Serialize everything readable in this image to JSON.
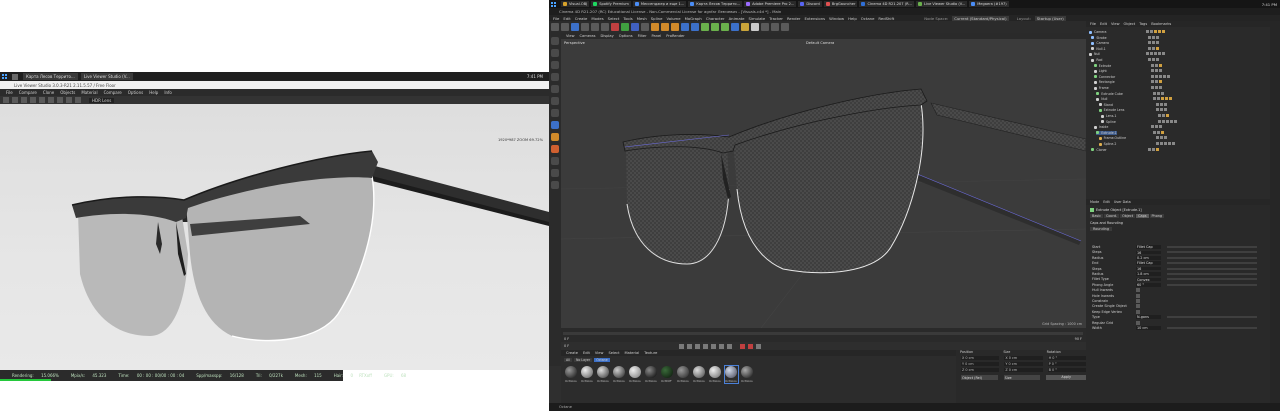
{
  "left_window": {
    "taskbar": {
      "tabs": [
        "Карта Лесов Террито...",
        "Live Viewer Studio (V..."
      ],
      "clock": "7:41 PM"
    },
    "titlebar": "Live Viewer Studio 3.0.3-R21 2.11.5.57 / Free Floor",
    "menus": [
      "File",
      "Compare",
      "Clone",
      "Objects",
      "Material",
      "Compare",
      "Options",
      "Help",
      "Info"
    ],
    "toolbar_dropdown": "HDR Lens",
    "viewport_label": "1920*987 ZOOM 69.72%",
    "status": {
      "rendering_label": "Rendering:",
      "rendering_value": "15.066%",
      "mpix_label": "Mpix/s:",
      "mpix_value": "45.323",
      "time_label": "Time:",
      "time_value": "00 : 00 : 00/00 : 00 : 04",
      "spp_label": "Spp/maxspp:",
      "spp_value": "16/128",
      "tri_label": "Tri:",
      "tri_value": "0/227k",
      "mesh_label": "Mesh:",
      "mesh_value": "115",
      "hair_label": "Hair:",
      "hair_value": "0",
      "rtx_label": "RTXoff",
      "gpu_label": "GPU:",
      "gpu_value": "68"
    },
    "progress": 0.15
  },
  "right_window": {
    "taskbar": {
      "tabs": [
        "Visual.OBJ",
        "Spotify Premium",
        "Мессенджер и еще 1...",
        "Карта Лесов Террито...",
        "Adobe Premiere Pro 2...",
        "Discord",
        "BrgGauncher",
        "Cinema 4D R21.207 (R...",
        "Live Viewer Studio (V...",
        "Megaera (#197)"
      ],
      "clock": "7:41 PM"
    },
    "titlebar": "Cinema 4D R21.207 (RC) Educational License - Non-Commercial License for agnfar Лемчевич - [Visuals.c4d *] - Main",
    "menus": [
      "File",
      "Edit",
      "Create",
      "Modes",
      "Select",
      "Tools",
      "Mesh",
      "Spline",
      "Volume",
      "MoGraph",
      "Character",
      "Animate",
      "Simulate",
      "Tracker",
      "Render",
      "Extensions",
      "Window",
      "Help",
      "Octane",
      "RedShift"
    ],
    "viewport_menus": [
      "View",
      "Cameras",
      "Display",
      "Options",
      "Filter",
      "Panel",
      "ProRender"
    ],
    "viewport_labels": {
      "camera": "Default Camera",
      "perspective": "Perspective",
      "grid_spacing": "Grid Spacing : 1000 cm"
    },
    "layout_label": "Layout:",
    "layout_value": "Startup (User)",
    "node_space_label": "Node Space:",
    "node_space_value": "Current (Standard/Physical)",
    "object_manager": {
      "menus": [
        "File",
        "Edit",
        "View",
        "Object",
        "Tags",
        "Bookmarks"
      ],
      "objects": [
        {
          "name": "Camera",
          "color": "#8fbfff"
        },
        {
          "name": "Stroke",
          "color": "#8fbfff"
        },
        {
          "name": "Camera",
          "color": "#8fbfff"
        },
        {
          "name": "Null.1",
          "color": "#cfcfcf"
        },
        {
          "name": "Null",
          "color": "#cfcfcf"
        },
        {
          "name": "Rod",
          "color": "#cfcfcf"
        },
        {
          "name": "Extrude",
          "color": "#7fd27f"
        },
        {
          "name": "Light",
          "color": "#cfcfcf"
        },
        {
          "name": "Connector",
          "color": "#7fd27f"
        },
        {
          "name": "Rectangle",
          "color": "#cfcfcf"
        },
        {
          "name": "Frame",
          "color": "#cfcfcf"
        },
        {
          "name": "Extrude Cube",
          "color": "#7fd27f"
        },
        {
          "name": "Null",
          "color": "#cfcfcf"
        },
        {
          "name": "Stand",
          "color": "#cfcfcf"
        },
        {
          "name": "Extrude Lens",
          "color": "#7fd27f"
        },
        {
          "name": "Lens.1",
          "color": "#cfcfcf"
        },
        {
          "name": "Spline",
          "color": "#cfcfcf"
        },
        {
          "name": "Inside",
          "color": "#cfcfcf"
        },
        {
          "name": "Extrude.1",
          "color": "#7fd27f"
        },
        {
          "name": "Frame.Outline",
          "color": "#e0b050"
        },
        {
          "name": "Spline.2",
          "color": "#e0b050"
        },
        {
          "name": "Cloner",
          "color": "#7fd27f"
        }
      ]
    },
    "attributes": {
      "menus": [
        "Mode",
        "Edit",
        "User Data"
      ],
      "object_title": "Extrude Object [Extrude.1]",
      "tabs": [
        "Basic",
        "Coord.",
        "Object",
        "Caps",
        "Phong"
      ],
      "section": "Caps and Rounding",
      "subsection": "Rounding",
      "rows": [
        {
          "label": "Start",
          "value": "Fillet Cap"
        },
        {
          "label": "Steps",
          "value": "16"
        },
        {
          "label": "Radius",
          "value": "0.2 cm"
        },
        {
          "label": "End",
          "value": "Fillet Cap"
        },
        {
          "label": "Steps",
          "value": "16"
        },
        {
          "label": "Radius",
          "value": "1.8 cm"
        },
        {
          "label": "Fillet Type",
          "value": "Convex"
        },
        {
          "label": "Phong Angle",
          "value": "60 °"
        },
        {
          "label": "Hull Inwards",
          "value": ""
        },
        {
          "label": "Hole Inwards",
          "value": ""
        },
        {
          "label": "Constrain",
          "value": ""
        },
        {
          "label": "Create Single Object",
          "value": ""
        },
        {
          "label": "Keep Edge Vertex",
          "value": ""
        },
        {
          "label": "Type",
          "value": "N-gons"
        },
        {
          "label": "Regular Grid",
          "value": ""
        },
        {
          "label": "Width",
          "value": "10 cm"
        }
      ]
    },
    "material_menus": [
      "Create",
      "Edit",
      "View",
      "Select",
      "Material",
      "Texture"
    ],
    "material_filter": [
      "All",
      "No Layer",
      "Octane"
    ],
    "materials": [
      "OctGlos",
      "OctGlos",
      "OctGlos",
      "OctGlos",
      "OctGlos",
      "OctGlos",
      "OctDiff",
      "OctGlos",
      "OctGlos",
      "OctGlos",
      "OctGlos",
      "OctGlos"
    ],
    "coordinates": {
      "headers": [
        "Position",
        "Size",
        "Rotation"
      ],
      "rows": [
        [
          "X  0 cm",
          "X  0 cm",
          "H  0 °"
        ],
        [
          "Y  0 cm",
          "Y  0 cm",
          "P  0 °"
        ],
        [
          "Z  0 cm",
          "Z  0 cm",
          "B  0 °"
        ]
      ],
      "mode": "Object (Rel)",
      "size_mode": "Size",
      "apply": "Apply"
    },
    "timeline": {
      "start": "0 F",
      "end": "90 F",
      "current": "0 F"
    },
    "bottom_status": "Octane"
  }
}
